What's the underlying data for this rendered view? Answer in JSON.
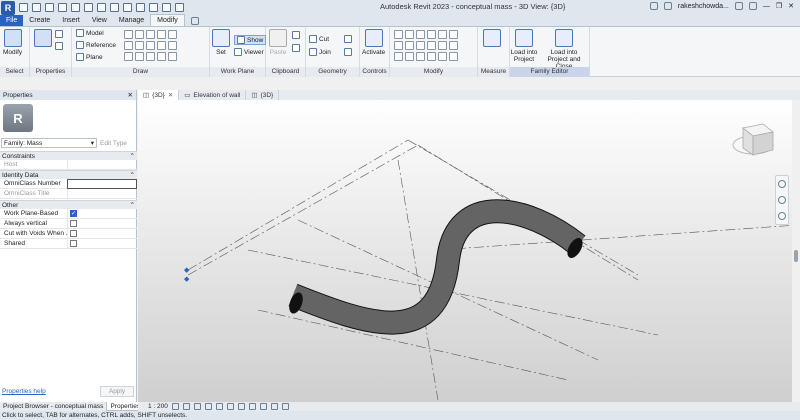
{
  "window": {
    "title": "Autodesk Revit 2023 - conceptual mass - 3D View: {3D}",
    "logo": "R",
    "user": "rakeshchowda..."
  },
  "tabs": [
    "File",
    "Create",
    "Insert",
    "View",
    "Manage",
    "Modify"
  ],
  "active_tab": "Modify",
  "ribbon": {
    "select_panel": {
      "label": "Select",
      "modify_label": "Modify"
    },
    "properties_panel": {
      "label": "Properties"
    },
    "draw_panel": {
      "label": "Draw",
      "model": "Model",
      "reference": "Reference",
      "plane": "Plane"
    },
    "work_plane_panel": {
      "label": "Work Plane",
      "set": "Set",
      "show": "Show",
      "viewer": "Viewer"
    },
    "clipboard_panel": {
      "label": "Clipboard",
      "paste": "Paste"
    },
    "geometry_panel": {
      "label": "Geometry",
      "cut": "Cut",
      "join": "Join"
    },
    "controls_panel": {
      "label": "Controls",
      "activate": "Activate"
    },
    "modify_panel": {
      "label": "Modify"
    },
    "measure_panel": {
      "label": "Measure"
    },
    "family_editor_panel": {
      "label": "Family Editor",
      "load_into_project": "Load into Project",
      "load_into_project_close": "Load into Project and Close"
    }
  },
  "properties": {
    "title": "Properties",
    "thumbnail": "R",
    "family": "Family: Mass",
    "edit_type": "Edit Type",
    "sections": {
      "constraints": "Constraints",
      "identity": "Identity Data",
      "other": "Other"
    },
    "rows": {
      "host": "Host",
      "omniclass_number": "OmniClass Number",
      "omniclass_title": "OmniClass Title",
      "work_plane_based": "Work Plane-Based",
      "always_vertical": "Always vertical",
      "cut_with_voids": "Cut with Voids When ...",
      "shared": "Shared"
    },
    "checks": {
      "work_plane_based": true,
      "always_vertical": false,
      "cut_with_voids": false,
      "shared": false
    },
    "help": "Properties help",
    "apply": "Apply"
  },
  "bottom_tabs": {
    "browser": "Project Browser - conceptual mass",
    "properties": "Properties"
  },
  "view_tabs": [
    {
      "label": "{3D}",
      "active": true
    },
    {
      "label": "Elevation of wall",
      "active": false
    },
    {
      "label": "{3D}",
      "active": false
    }
  ],
  "view_bar": {
    "scale": "1 : 200"
  },
  "status": "Click to select, TAB for alternates, CTRL adds, SHIFT unselects."
}
